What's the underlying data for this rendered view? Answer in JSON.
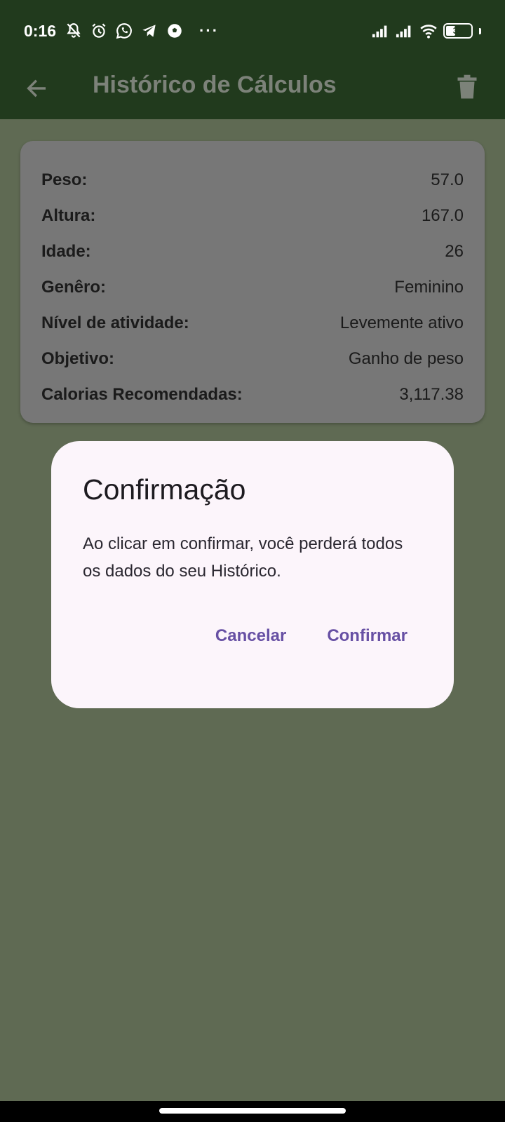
{
  "status_bar": {
    "time": "0:16",
    "more_indicator": "···",
    "battery_level": "39",
    "battery_fraction": 0.39,
    "left_icons": [
      "muted-notification-icon",
      "alarm-icon",
      "whatsapp-icon",
      "telegram-icon",
      "soccer-ball-icon"
    ],
    "right_icons": [
      "signal-icon",
      "signal-icon",
      "wifi-icon",
      "battery-icon"
    ]
  },
  "app_bar": {
    "title": "Histórico de Cálculos",
    "back_icon": "arrow-back-icon",
    "delete_icon": "trash-icon",
    "background": "#213a1d"
  },
  "history_card": {
    "rows": [
      {
        "label": "Peso:",
        "value": "57.0"
      },
      {
        "label": "Altura:",
        "value": "167.0"
      },
      {
        "label": "Idade:",
        "value": "26"
      },
      {
        "label": "Genêro:",
        "value": "Feminino"
      },
      {
        "label": "Nível de atividade:",
        "value": "Levemente ativo"
      },
      {
        "label": "Objetivo:",
        "value": "Ganho de peso"
      },
      {
        "label": "Calorias Recomendadas:",
        "value": "3,117.38"
      }
    ]
  },
  "dialog": {
    "title": "Confirmação",
    "message": "Ao clicar em confirmar, você perderá todos os dados do seu Histórico.",
    "cancel_label": "Cancelar",
    "confirm_label": "Confirmar",
    "accent": "#6750a4"
  }
}
